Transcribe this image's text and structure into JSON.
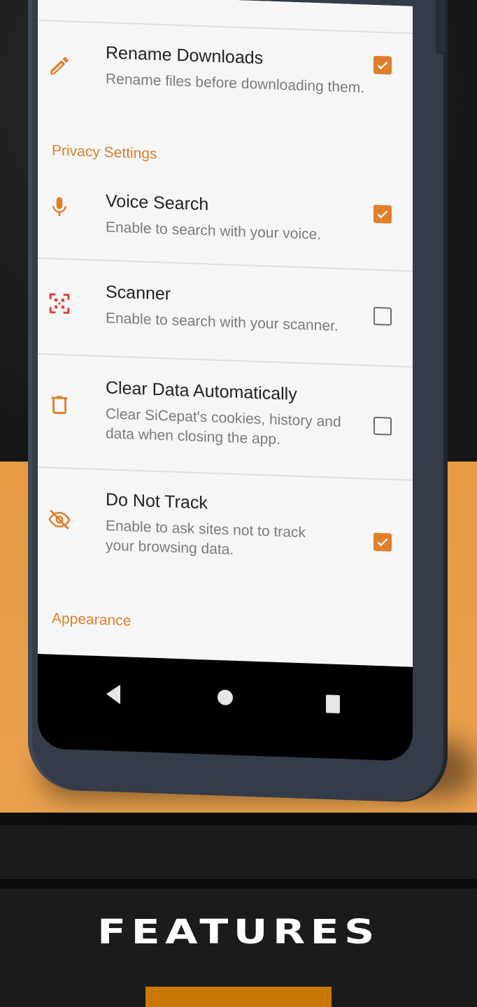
{
  "colors": {
    "accent": "#e0802a",
    "background_orange": "#e89a45",
    "phone_frame": "#333c48",
    "danger_icon": "#e53935"
  },
  "settings": {
    "rename_downloads": {
      "title": "Rename Downloads",
      "subtitle": "Rename files before downloading them.",
      "icon": "pencil-icon",
      "checked": true
    },
    "privacy_header": "Privacy Settings",
    "voice_search": {
      "title": "Voice Search",
      "subtitle": "Enable to search with your voice.",
      "icon": "microphone-icon",
      "checked": true
    },
    "scanner": {
      "title": "Scanner",
      "subtitle": "Enable to search with your scanner.",
      "icon": "qr-scanner-icon",
      "checked": false
    },
    "clear_data": {
      "title": "Clear Data Automatically",
      "subtitle": "Clear SiCepat's cookies, history and data when closing the app.",
      "icon": "trash-icon",
      "checked": false
    },
    "do_not_track": {
      "title": "Do Not Track",
      "subtitle": "Enable to ask sites not to track your browsing data.",
      "icon": "eye-off-icon",
      "checked": true
    },
    "appearance_header": "Appearance"
  },
  "navbar": {
    "back_icon": "back-triangle-icon",
    "home_icon": "home-circle-icon",
    "recents_icon": "recents-square-icon"
  },
  "promo": {
    "headline": "FEATURES"
  }
}
